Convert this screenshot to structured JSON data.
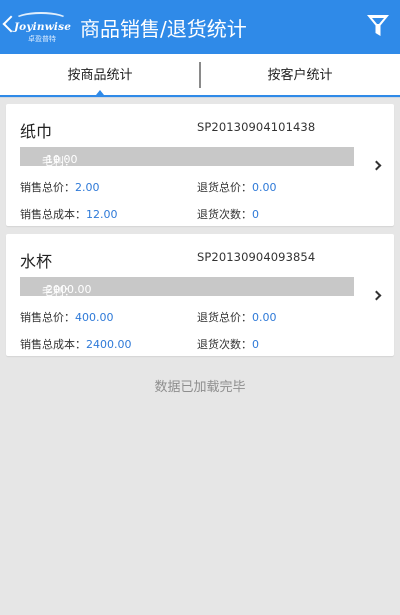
{
  "header": {
    "back_icon": "chevron-left-icon",
    "logo_text": "Joyinwise",
    "logo_subtext": "卓盈普特",
    "title": "商品销售/退货统计",
    "filter_icon": "filter-funnel-icon",
    "background_color": "#2f8ae8"
  },
  "tabs": [
    {
      "label": "按商品统计",
      "active": true
    },
    {
      "label": "按客户统计",
      "active": false
    }
  ],
  "labels": {
    "profit": "毛利：",
    "sales_total": "销售总价：",
    "returns_total": "退货总价：",
    "sales_cost": "销售总成本：",
    "returns_count": "退货次数："
  },
  "items": [
    {
      "name": "纸巾",
      "code": "SP20130904101438",
      "profit": "-10.00",
      "sales_total": "2.00",
      "returns_total": "0.00",
      "sales_cost": "12.00",
      "returns_count": "0"
    },
    {
      "name": "水杯",
      "code": "SP20130904093854",
      "profit": "-2000.00",
      "sales_total": "400.00",
      "returns_total": "0.00",
      "sales_cost": "2400.00",
      "returns_count": "0"
    }
  ],
  "footer": {
    "status": "数据已加载完毕"
  },
  "colors": {
    "accent": "#2f8ae8",
    "value_text": "#2f7ad8",
    "profit_bar": "#c8c8c8",
    "page_bg": "#e6e6e6"
  }
}
